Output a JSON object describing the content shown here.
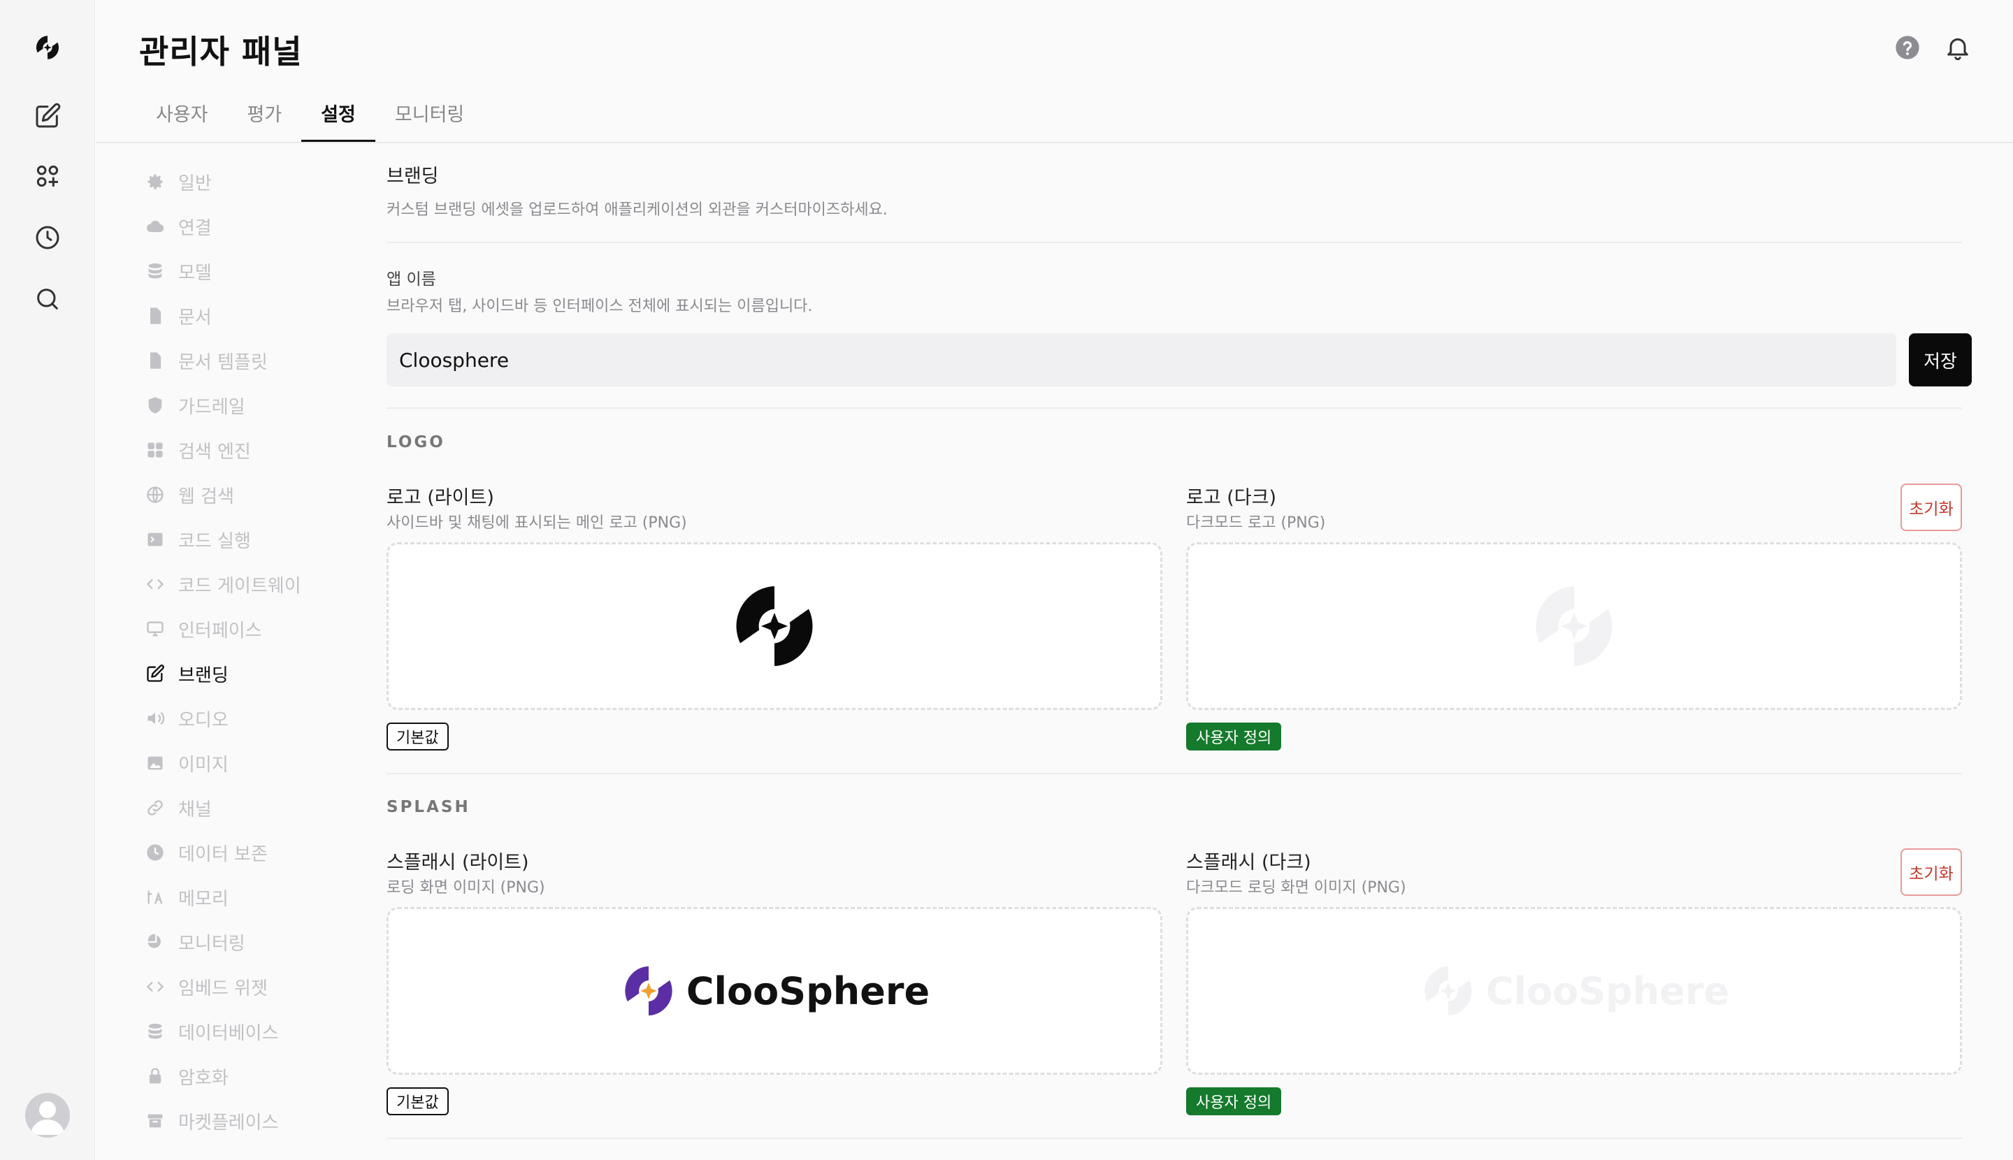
{
  "header": {
    "title": "관리자 패널",
    "icons": [
      "help-icon",
      "bell-icon"
    ]
  },
  "tabs": [
    {
      "label": "사용자"
    },
    {
      "label": "평가"
    },
    {
      "label": "설정"
    },
    {
      "label": "모니터링"
    }
  ],
  "settings_nav": [
    {
      "label": "일반",
      "icon": "gear-icon"
    },
    {
      "label": "연결",
      "icon": "cloud-icon"
    },
    {
      "label": "모델",
      "icon": "database-icon"
    },
    {
      "label": "문서",
      "icon": "document-icon"
    },
    {
      "label": "문서 템플릿",
      "icon": "document-template-icon"
    },
    {
      "label": "가드레일",
      "icon": "shield-icon"
    },
    {
      "label": "검색 엔진",
      "icon": "grid-icon"
    },
    {
      "label": "웹 검색",
      "icon": "globe-icon"
    },
    {
      "label": "코드 실행",
      "icon": "terminal-icon"
    },
    {
      "label": "코드 게이트웨이",
      "icon": "code-icon"
    },
    {
      "label": "인터페이스",
      "icon": "monitor-icon"
    },
    {
      "label": "브랜딩",
      "icon": "edit-icon"
    },
    {
      "label": "오디오",
      "icon": "speaker-icon"
    },
    {
      "label": "이미지",
      "icon": "image-icon"
    },
    {
      "label": "채널",
      "icon": "link-icon"
    },
    {
      "label": "데이터 보존",
      "icon": "clock-icon"
    },
    {
      "label": "메모리",
      "icon": "memory-icon"
    },
    {
      "label": "모니터링",
      "icon": "monitoring-icon"
    },
    {
      "label": "임베드 위젯",
      "icon": "code-icon"
    },
    {
      "label": "데이터베이스",
      "icon": "database-icon"
    },
    {
      "label": "암호화",
      "icon": "lock-icon"
    },
    {
      "label": "마켓플레이스",
      "icon": "store-icon"
    }
  ],
  "branding": {
    "title": "브랜딩",
    "description": "커스텀 브랜딩 에셋을 업로드하여 애플리케이션의 외관을 커스터마이즈하세요.",
    "app_name_label": "앱 이름",
    "app_name_help": "브라우저 탭, 사이드바 등 인터페이스 전체에 표시되는 이름입니다.",
    "app_name_value": "Cloosphere",
    "save_label": "저장",
    "logo_section": "LOGO",
    "logo_light_title": "로고 (라이트)",
    "logo_light_sub": "사이드바 및 채팅에 표시되는 메인 로고 (PNG)",
    "logo_dark_title": "로고 (다크)",
    "logo_dark_sub": "다크모드 로고 (PNG)",
    "splash_section": "SPLASH",
    "splash_light_title": "스플래시 (라이트)",
    "splash_light_sub": "로딩 화면 이미지 (PNG)",
    "splash_dark_title": "스플래시 (다크)",
    "splash_dark_sub": "다크모드 로딩 화면 이미지 (PNG)",
    "splash_wordmark": "ClooSphere",
    "tag_default": "기본값",
    "tag_custom": "사용자 정의",
    "reset_label": "초기화"
  },
  "colors": {
    "accent_purple": "#5b2ea6",
    "accent_orange": "#f0a030",
    "custom_tag_green": "#157a2c",
    "reset_red": "#c0392b"
  }
}
